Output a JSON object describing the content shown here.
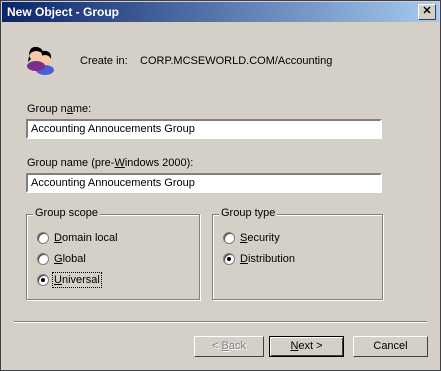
{
  "window": {
    "title": "New Object - Group",
    "close_glyph": "✕"
  },
  "create_in": {
    "label": "Create in:",
    "path": "CORP.MCSEWORLD.COM/Accounting"
  },
  "group_name": {
    "label_pre": "Group n",
    "label_ul": "a",
    "label_post": "me:",
    "value": "Accounting Annoucements Group"
  },
  "group_name_legacy": {
    "label_pre": "Group name (pre-",
    "label_ul": "W",
    "label_post": "indows 2000):",
    "value": "Accounting Annoucements Group"
  },
  "group_scope": {
    "title": "Group scope",
    "options": [
      {
        "pre": "",
        "ul": "D",
        "post": "omain local",
        "checked": false
      },
      {
        "pre": "",
        "ul": "G",
        "post": "lobal",
        "checked": false
      },
      {
        "pre": "",
        "ul": "U",
        "post": "niversal",
        "checked": true
      }
    ]
  },
  "group_type": {
    "title": "Group type",
    "options": [
      {
        "pre": "",
        "ul": "S",
        "post": "ecurity",
        "checked": false
      },
      {
        "pre": "",
        "ul": "D",
        "post": "istribution",
        "checked": true
      }
    ]
  },
  "buttons": {
    "back": {
      "pre": "< ",
      "ul": "B",
      "post": "ack"
    },
    "next": {
      "pre": "",
      "ul": "N",
      "post": "ext >"
    },
    "cancel": "Cancel"
  }
}
